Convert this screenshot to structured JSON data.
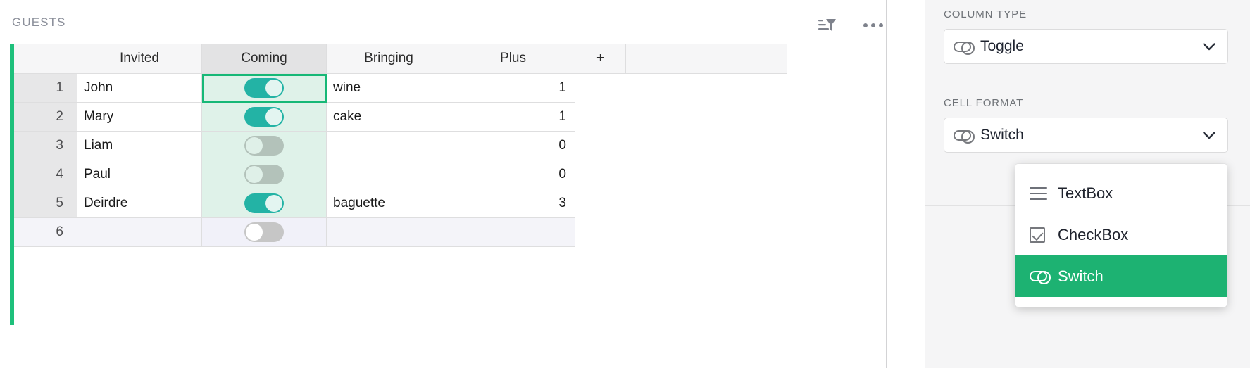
{
  "grid": {
    "title": "GUESTS",
    "toolbar": {
      "filter_sort_icon": "filter-sort-icon",
      "more_icon": "more-horizontal-icon"
    },
    "columns": [
      {
        "key": "index",
        "label": ""
      },
      {
        "key": "invited",
        "label": "Invited"
      },
      {
        "key": "coming",
        "label": "Coming"
      },
      {
        "key": "bringing",
        "label": "Bringing"
      },
      {
        "key": "plus",
        "label": "Plus"
      },
      {
        "key": "add",
        "label": "+"
      },
      {
        "key": "tail",
        "label": ""
      }
    ],
    "selected_column": "Coming",
    "active_cell": {
      "row": 1,
      "column": "Coming"
    },
    "rows": [
      {
        "index": "1",
        "invited": "John",
        "coming": true,
        "bringing": "wine",
        "plus": "1"
      },
      {
        "index": "2",
        "invited": "Mary",
        "coming": true,
        "bringing": "cake",
        "plus": "1"
      },
      {
        "index": "3",
        "invited": "Liam",
        "coming": false,
        "bringing": "",
        "plus": "0"
      },
      {
        "index": "4",
        "invited": "Paul",
        "coming": false,
        "bringing": "",
        "plus": "0"
      },
      {
        "index": "5",
        "invited": "Deirdre",
        "coming": true,
        "bringing": "baguette",
        "plus": "3"
      },
      {
        "index": "6",
        "invited": "",
        "coming": false,
        "bringing": "",
        "plus": ""
      }
    ]
  },
  "inspector": {
    "column_type": {
      "label": "COLUMN TYPE",
      "value": "Toggle",
      "icon": "switch-pill-icon",
      "chevron": "chevron-down-icon"
    },
    "cell_format": {
      "label": "CELL FORMAT",
      "value": "Switch",
      "icon": "switch-pill-icon",
      "chevron": "chevron-down-icon",
      "open": true,
      "options": [
        {
          "label": "TextBox",
          "icon": "lines-icon",
          "selected": false
        },
        {
          "label": "CheckBox",
          "icon": "checkbox-icon",
          "selected": false
        },
        {
          "label": "Switch",
          "icon": "switch-pill-icon",
          "selected": true
        }
      ]
    }
  },
  "colors": {
    "accent_green": "#1ec07b",
    "menu_highlight": "#1db272",
    "toggle_on": "#23b3a5",
    "toggle_off": "#b3c2ba",
    "selected_column_tint": "#dff2e9",
    "new_row_tint": "#f4f4f9",
    "panel_bg": "#f5f5f6"
  }
}
